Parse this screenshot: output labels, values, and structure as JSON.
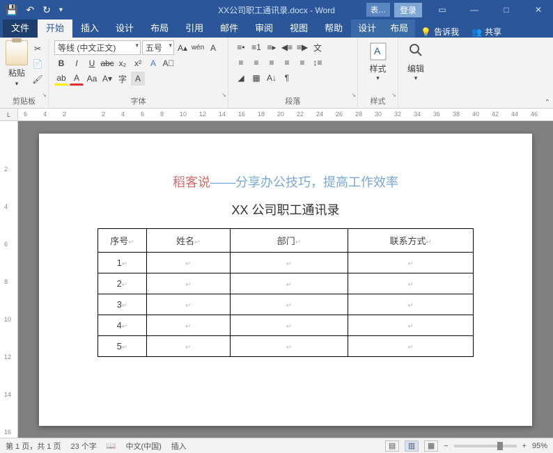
{
  "titlebar": {
    "doc_title": "XX公司职工通讯录.docx - Word",
    "contextual_badge": "表…",
    "login": "登录"
  },
  "tabs": {
    "file": "文件",
    "home": "开始",
    "insert": "插入",
    "design": "设计",
    "layout": "布局",
    "references": "引用",
    "mail": "邮件",
    "review": "审阅",
    "view": "视图",
    "help": "帮助",
    "ctx_design": "设计",
    "ctx_layout": "布局",
    "tellme": "告诉我",
    "share": "共享"
  },
  "ribbon": {
    "clipboard": {
      "paste": "粘贴",
      "label": "剪贴板"
    },
    "font": {
      "family": "等线 (中文正文)",
      "size": "五号",
      "label": "字体"
    },
    "paragraph": {
      "label": "段落"
    },
    "styles": {
      "btn": "样式",
      "label": "样式"
    },
    "editing": {
      "btn": "编辑"
    }
  },
  "ruler_h": [
    6,
    4,
    2,
    "",
    2,
    4,
    6,
    8,
    10,
    12,
    14,
    16,
    18,
    20,
    22,
    24,
    26,
    28,
    30,
    32,
    34,
    36,
    38,
    40,
    42,
    44,
    46
  ],
  "ruler_v": [
    "",
    "",
    2,
    "",
    4,
    "",
    6,
    "",
    8,
    "",
    10,
    "",
    12,
    "",
    14,
    "",
    16
  ],
  "document": {
    "headline_red": "稻客说",
    "headline_dash": "——",
    "headline_blue": "分享办公技巧，提高工作效率",
    "subtitle": "XX 公司职工通讯录",
    "headers": [
      "序号",
      "姓名",
      "部门",
      "联系方式"
    ],
    "rows": [
      "1",
      "2",
      "3",
      "4",
      "5"
    ]
  },
  "status": {
    "page": "第 1 页，共 1 页",
    "words": "23 个字",
    "lang": "中文(中国)",
    "mode": "插入",
    "zoom": "95%"
  }
}
